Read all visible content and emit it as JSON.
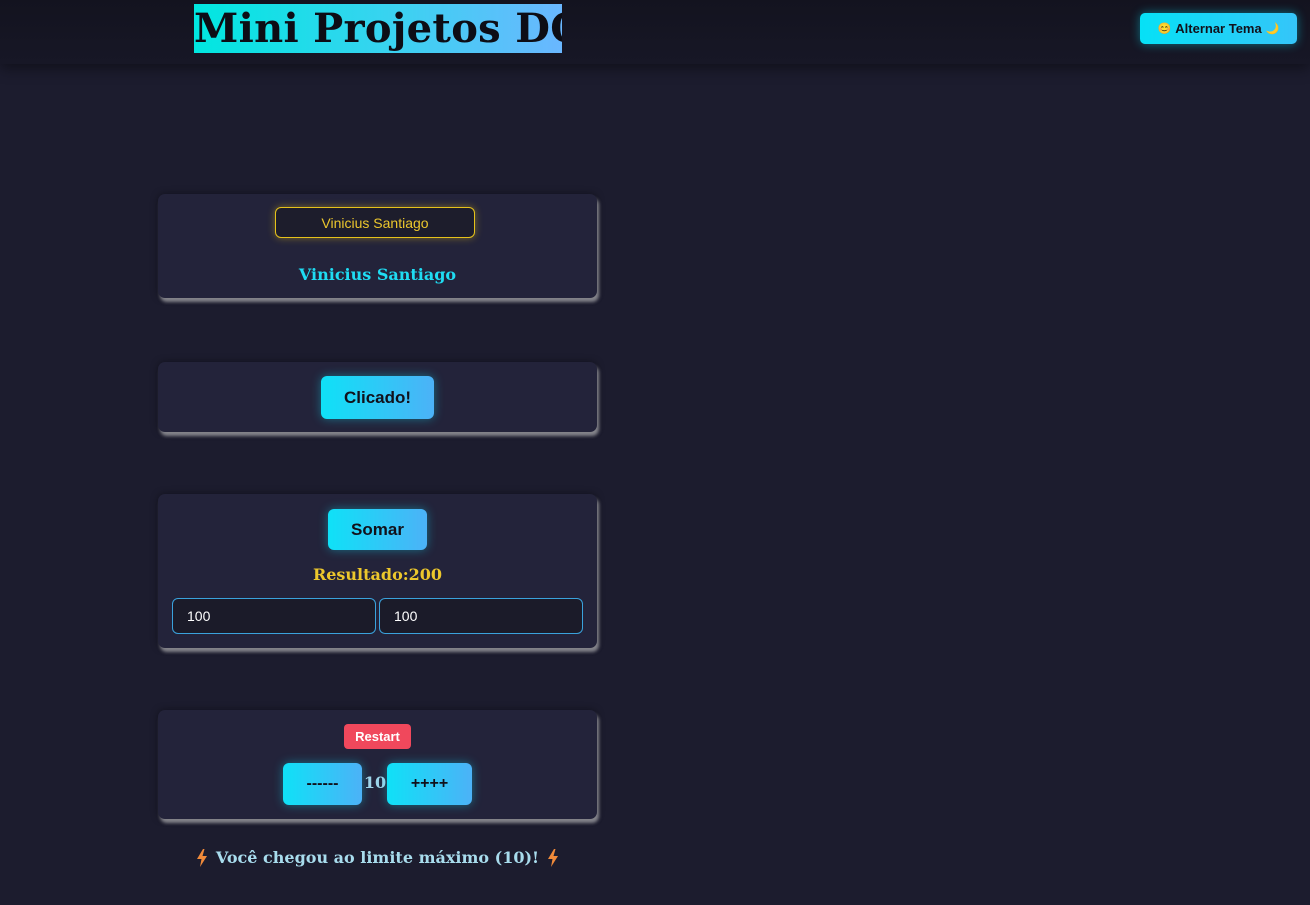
{
  "header": {
    "title": "Mini Projetos DOM",
    "theme_button": {
      "emoji_left": "😊",
      "label": "Alternar Tema",
      "emoji_right": "🌙"
    }
  },
  "name_card": {
    "input_value": "Vinicius Santiago",
    "display_text": "Vinicius Santiago"
  },
  "click_card": {
    "button_label": "Clicado!"
  },
  "sum_card": {
    "button_label": "Somar",
    "result_text": "Resultado:200",
    "value_a": "100",
    "value_b": "100"
  },
  "counter_card": {
    "restart_label": "Restart",
    "decrement_label": "------",
    "count": "10",
    "increment_label": "++++"
  },
  "limit_message": {
    "text": "Você chegou ao limite máximo (10)!",
    "icon": "lightning-icon"
  },
  "colors": {
    "background": "#1c1c2e",
    "card": "#23233a",
    "accent_cyan": "#0fe1f7",
    "accent_yellow": "#ecc72c",
    "restart_red": "#f0485c"
  }
}
